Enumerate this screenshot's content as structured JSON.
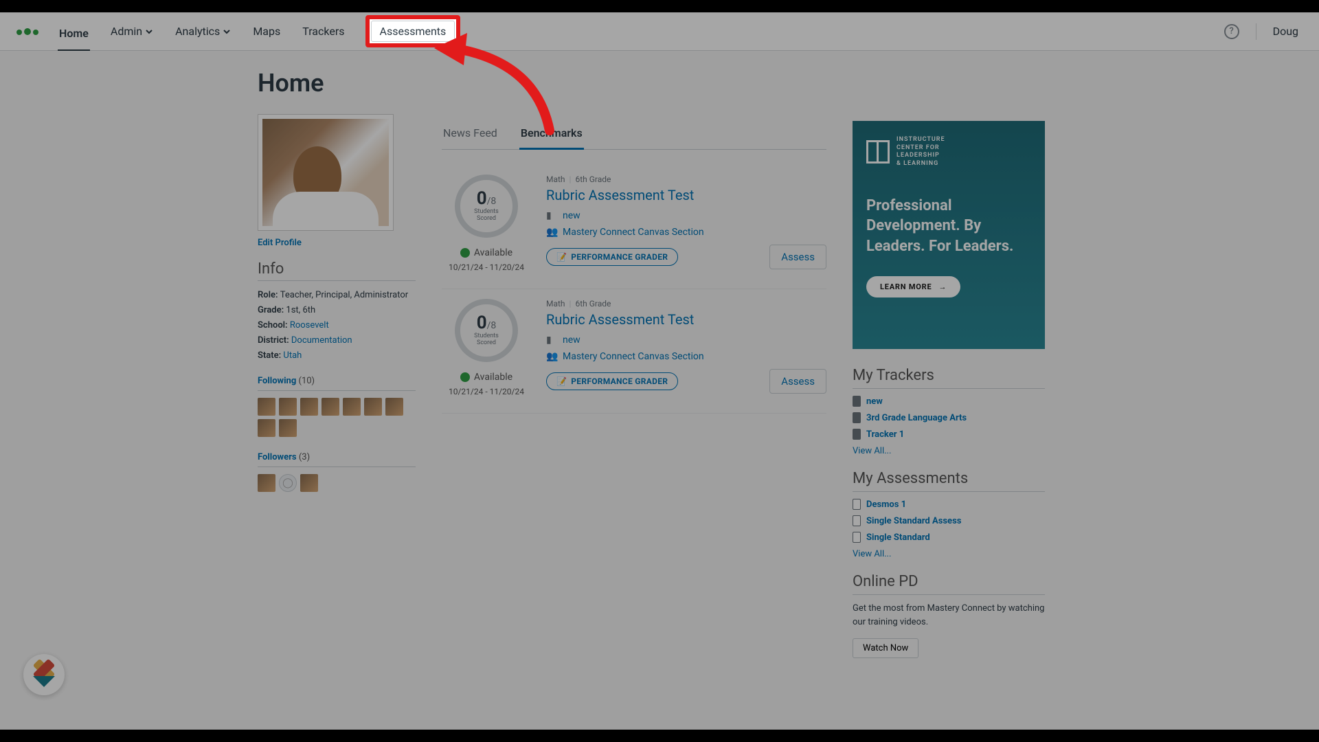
{
  "nav": {
    "items": [
      "Home",
      "Admin",
      "Analytics",
      "Maps",
      "Trackers",
      "Assessments"
    ],
    "highlighted_index": 5,
    "active_index": 0,
    "user": "Doug"
  },
  "page_title": "Home",
  "profile": {
    "edit_link": "Edit Profile",
    "info_title": "Info",
    "rows": [
      {
        "label": "Role:",
        "value": "Teacher, Principal, Administrator",
        "link": false
      },
      {
        "label": "Grade:",
        "value": "1st, 6th",
        "link": false
      },
      {
        "label": "School:",
        "value": "Roosevelt",
        "link": true
      },
      {
        "label": "District:",
        "value": "Documentation",
        "link": true
      },
      {
        "label": "State:",
        "value": "Utah",
        "link": true
      }
    ],
    "following": {
      "label": "Following",
      "count": "(10)",
      "avatars": 9
    },
    "followers": {
      "label": "Followers",
      "count": "(3)",
      "avatars": 3
    }
  },
  "tabs": {
    "items": [
      "News Feed",
      "Benchmarks"
    ],
    "active": 1
  },
  "benchmarks": [
    {
      "scored_num": "0",
      "scored_den": "/8",
      "scored_label": "Students\nScored",
      "available": "Available",
      "dates": "10/21/24 - 11/20/24",
      "subject": "Math",
      "grade": "6th Grade",
      "title": "Rubric Assessment Test",
      "tracker": "new",
      "section": "Mastery Connect Canvas Section",
      "perf": "PERFORMANCE GRADER",
      "assess": "Assess"
    },
    {
      "scored_num": "0",
      "scored_den": "/8",
      "scored_label": "Students\nScored",
      "available": "Available",
      "dates": "10/21/24 - 11/20/24",
      "subject": "Math",
      "grade": "6th Grade",
      "title": "Rubric Assessment Test",
      "tracker": "new",
      "section": "Mastery Connect Canvas Section",
      "perf": "PERFORMANCE GRADER",
      "assess": "Assess"
    }
  ],
  "promo": {
    "logo_text": "INSTRUCTURE\nCENTER FOR\nLEADERSHIP\n& LEARNING",
    "headline": "Professional Development. By Leaders. For Leaders.",
    "cta": "LEARN MORE"
  },
  "sidebar": {
    "trackers": {
      "title": "My Trackers",
      "items": [
        "new",
        "3rd Grade Language Arts",
        "Tracker 1"
      ],
      "view_all": "View All..."
    },
    "assessments": {
      "title": "My Assessments",
      "items": [
        "Desmos 1",
        "Single Standard Assess",
        "Single Standard"
      ],
      "view_all": "View All..."
    },
    "pd": {
      "title": "Online PD",
      "text": "Get the most from Mastery Connect by watching our training videos.",
      "cta": "Watch Now"
    }
  }
}
